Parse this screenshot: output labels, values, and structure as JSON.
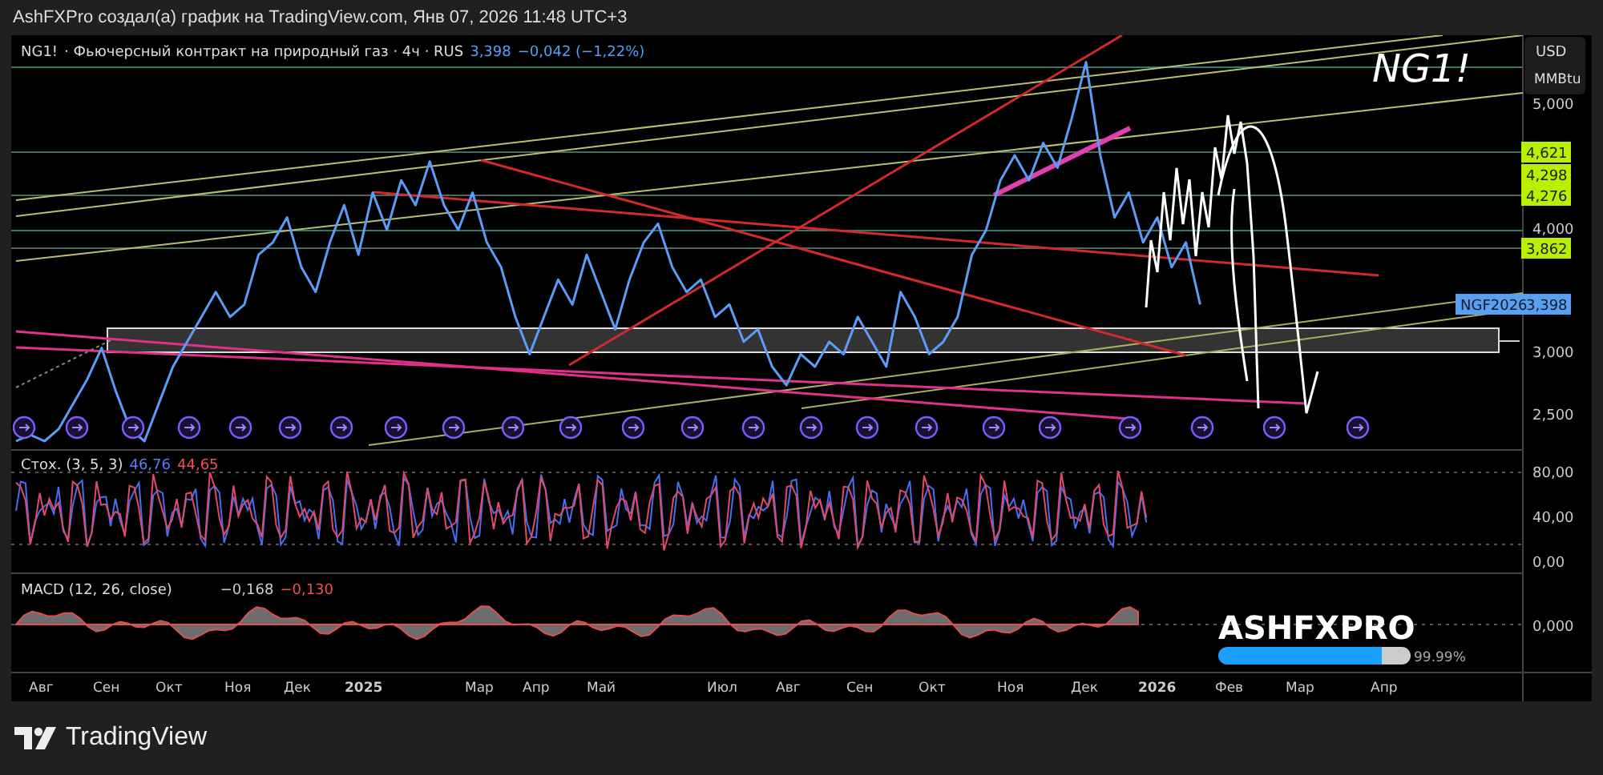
{
  "header": {
    "text": "AshFXPro создал(а) график на TradingView.com, Янв 07, 2026 11:48 UTC+3"
  },
  "chart": {
    "legend": "· Фьючерсный контракт на природный газ · 4ч · RUS",
    "last_price": "3,398",
    "change": "−0,042 (−1,22%)",
    "annotation": "NG1!",
    "currency": "USD",
    "unit": "MMBtu",
    "symbol": "NG1!",
    "price_axis": [
      "5,000",
      "4,000",
      "3,000",
      "2,500"
    ],
    "price_labels": [
      {
        "text": "4,621",
        "kind": "level"
      },
      {
        "text": "4,298",
        "kind": "level"
      },
      {
        "text": "4,276",
        "kind": "level"
      },
      {
        "text": "3,862",
        "kind": "level"
      },
      {
        "label": "NGF2026",
        "text": "3,398",
        "kind": "current"
      }
    ]
  },
  "stochastic": {
    "title": "Стох. (3, 5, 3)",
    "k": "46,76",
    "d": "44,65",
    "axis": [
      "80,00",
      "40,00",
      "0,00"
    ]
  },
  "macd": {
    "title": "MACD (12, 26, close)",
    "macd": "−0,168",
    "signal": "−0,130",
    "axis": [
      "0,000"
    ]
  },
  "time_axis": [
    {
      "label": "Авг",
      "kind": "month"
    },
    {
      "label": "Сен",
      "kind": "month"
    },
    {
      "label": "Окт",
      "kind": "month"
    },
    {
      "label": "Ноя",
      "kind": "month"
    },
    {
      "label": "Дек",
      "kind": "month"
    },
    {
      "label": "2025",
      "kind": "year"
    },
    {
      "label": "Мар",
      "kind": "month"
    },
    {
      "label": "Апр",
      "kind": "month"
    },
    {
      "label": "Май",
      "kind": "month"
    },
    {
      "label": "Июл",
      "kind": "month"
    },
    {
      "label": "Авг",
      "kind": "month"
    },
    {
      "label": "Сен",
      "kind": "month"
    },
    {
      "label": "Окт",
      "kind": "month"
    },
    {
      "label": "Ноя",
      "kind": "month"
    },
    {
      "label": "Дек",
      "kind": "month"
    },
    {
      "label": "2026",
      "kind": "year"
    },
    {
      "label": "Фев",
      "kind": "month"
    },
    {
      "label": "Мар",
      "kind": "month"
    },
    {
      "label": "Апр",
      "kind": "month"
    }
  ],
  "brand": {
    "name": "ASHFXPRO",
    "level": 0.85,
    "percent": "99.99%"
  },
  "footer": {
    "brand": "TradingView"
  }
}
